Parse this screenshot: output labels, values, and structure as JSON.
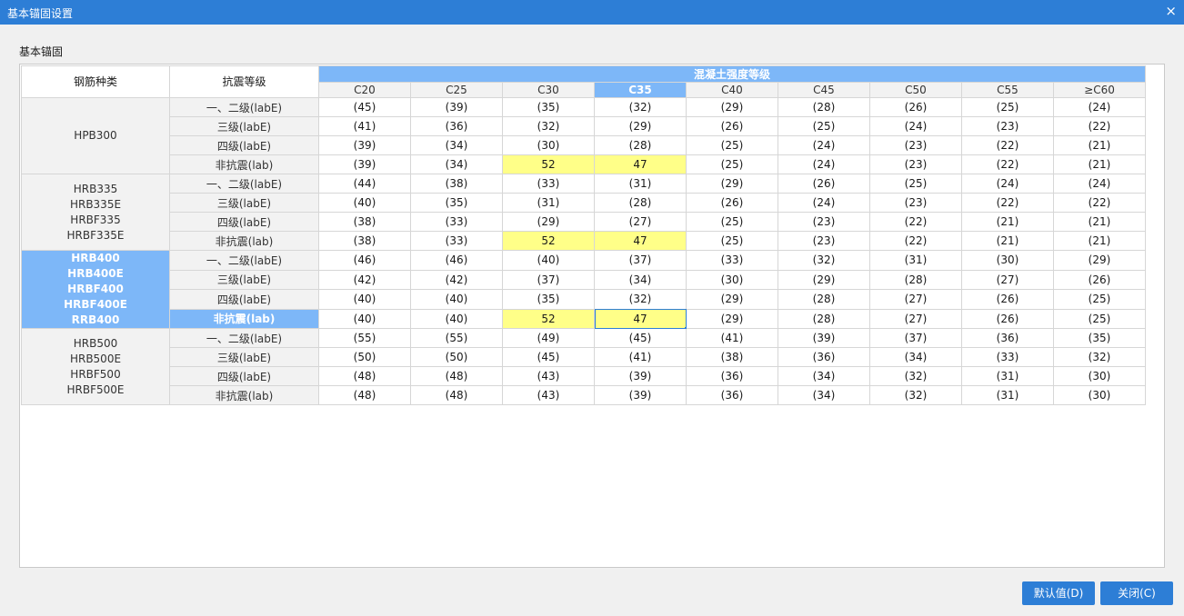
{
  "window": {
    "title": "基本锚固设置",
    "close_glyph": "×"
  },
  "section_label": "基本锚固",
  "table": {
    "col_steel": "钢筋种类",
    "col_seismic": "抗震等级",
    "concrete_header": "混凝土强度等级",
    "grades": [
      "C20",
      "C25",
      "C30",
      "C35",
      "C40",
      "C45",
      "C50",
      "C55",
      "≥C60"
    ],
    "selected_grade_index": 3,
    "groups": [
      {
        "steel_lines": [
          "HPB300"
        ],
        "selected": false,
        "rows": [
          {
            "seismic": "一、二级(labE)",
            "values": [
              "(45)",
              "(39)",
              "(35)",
              "(32)",
              "(29)",
              "(28)",
              "(26)",
              "(25)",
              "(24)"
            ]
          },
          {
            "seismic": "三级(labE)",
            "values": [
              "(41)",
              "(36)",
              "(32)",
              "(29)",
              "(26)",
              "(25)",
              "(24)",
              "(23)",
              "(22)"
            ]
          },
          {
            "seismic": "四级(labE)",
            "values": [
              "(39)",
              "(34)",
              "(30)",
              "(28)",
              "(25)",
              "(24)",
              "(23)",
              "(22)",
              "(21)"
            ]
          },
          {
            "seismic": "非抗震(lab)",
            "values": [
              "(39)",
              "(34)",
              "52",
              "47",
              "(25)",
              "(24)",
              "(23)",
              "(22)",
              "(21)"
            ]
          }
        ]
      },
      {
        "steel_lines": [
          "HRB335",
          "HRB335E",
          "HRBF335",
          "HRBF335E"
        ],
        "selected": false,
        "rows": [
          {
            "seismic": "一、二级(labE)",
            "values": [
              "(44)",
              "(38)",
              "(33)",
              "(31)",
              "(29)",
              "(26)",
              "(25)",
              "(24)",
              "(24)"
            ]
          },
          {
            "seismic": "三级(labE)",
            "values": [
              "(40)",
              "(35)",
              "(31)",
              "(28)",
              "(26)",
              "(24)",
              "(23)",
              "(22)",
              "(22)"
            ]
          },
          {
            "seismic": "四级(labE)",
            "values": [
              "(38)",
              "(33)",
              "(29)",
              "(27)",
              "(25)",
              "(23)",
              "(22)",
              "(21)",
              "(21)"
            ]
          },
          {
            "seismic": "非抗震(lab)",
            "values": [
              "(38)",
              "(33)",
              "52",
              "47",
              "(25)",
              "(23)",
              "(22)",
              "(21)",
              "(21)"
            ]
          }
        ]
      },
      {
        "steel_lines": [
          "HRB400",
          "HRB400E",
          "HRBF400",
          "HRBF400E",
          "RRB400"
        ],
        "selected": true,
        "rows": [
          {
            "seismic": "一、二级(labE)",
            "values": [
              "(46)",
              "(46)",
              "(40)",
              "(37)",
              "(33)",
              "(32)",
              "(31)",
              "(30)",
              "(29)"
            ]
          },
          {
            "seismic": "三级(labE)",
            "values": [
              "(42)",
              "(42)",
              "(37)",
              "(34)",
              "(30)",
              "(29)",
              "(28)",
              "(27)",
              "(26)"
            ]
          },
          {
            "seismic": "四级(labE)",
            "values": [
              "(40)",
              "(40)",
              "(35)",
              "(32)",
              "(29)",
              "(28)",
              "(27)",
              "(26)",
              "(25)"
            ]
          },
          {
            "seismic": "非抗震(lab)",
            "values": [
              "(40)",
              "(40)",
              "52",
              "47",
              "(29)",
              "(28)",
              "(27)",
              "(26)",
              "(25)"
            ]
          }
        ]
      },
      {
        "steel_lines": [
          "HRB500",
          "HRB500E",
          "HRBF500",
          "HRBF500E"
        ],
        "selected": false,
        "rows": [
          {
            "seismic": "一、二级(labE)",
            "values": [
              "(55)",
              "(55)",
              "(49)",
              "(45)",
              "(41)",
              "(39)",
              "(37)",
              "(36)",
              "(35)"
            ]
          },
          {
            "seismic": "三级(labE)",
            "values": [
              "(50)",
              "(50)",
              "(45)",
              "(41)",
              "(38)",
              "(36)",
              "(34)",
              "(33)",
              "(32)"
            ]
          },
          {
            "seismic": "四级(labE)",
            "values": [
              "(48)",
              "(48)",
              "(43)",
              "(39)",
              "(36)",
              "(34)",
              "(32)",
              "(31)",
              "(30)"
            ]
          },
          {
            "seismic": "非抗震(lab)",
            "values": [
              "(48)",
              "(48)",
              "(43)",
              "(39)",
              "(36)",
              "(34)",
              "(32)",
              "(31)",
              "(30)"
            ]
          }
        ]
      }
    ],
    "selected_cell": {
      "group": 2,
      "row": 3,
      "col": 3
    }
  },
  "buttons": {
    "default_label": "默认值(D)",
    "close_label": "关闭(C)"
  },
  "colors": {
    "accent": "#2d7ed6",
    "selection": "#7db7f8",
    "highlight": "#ffff88"
  }
}
